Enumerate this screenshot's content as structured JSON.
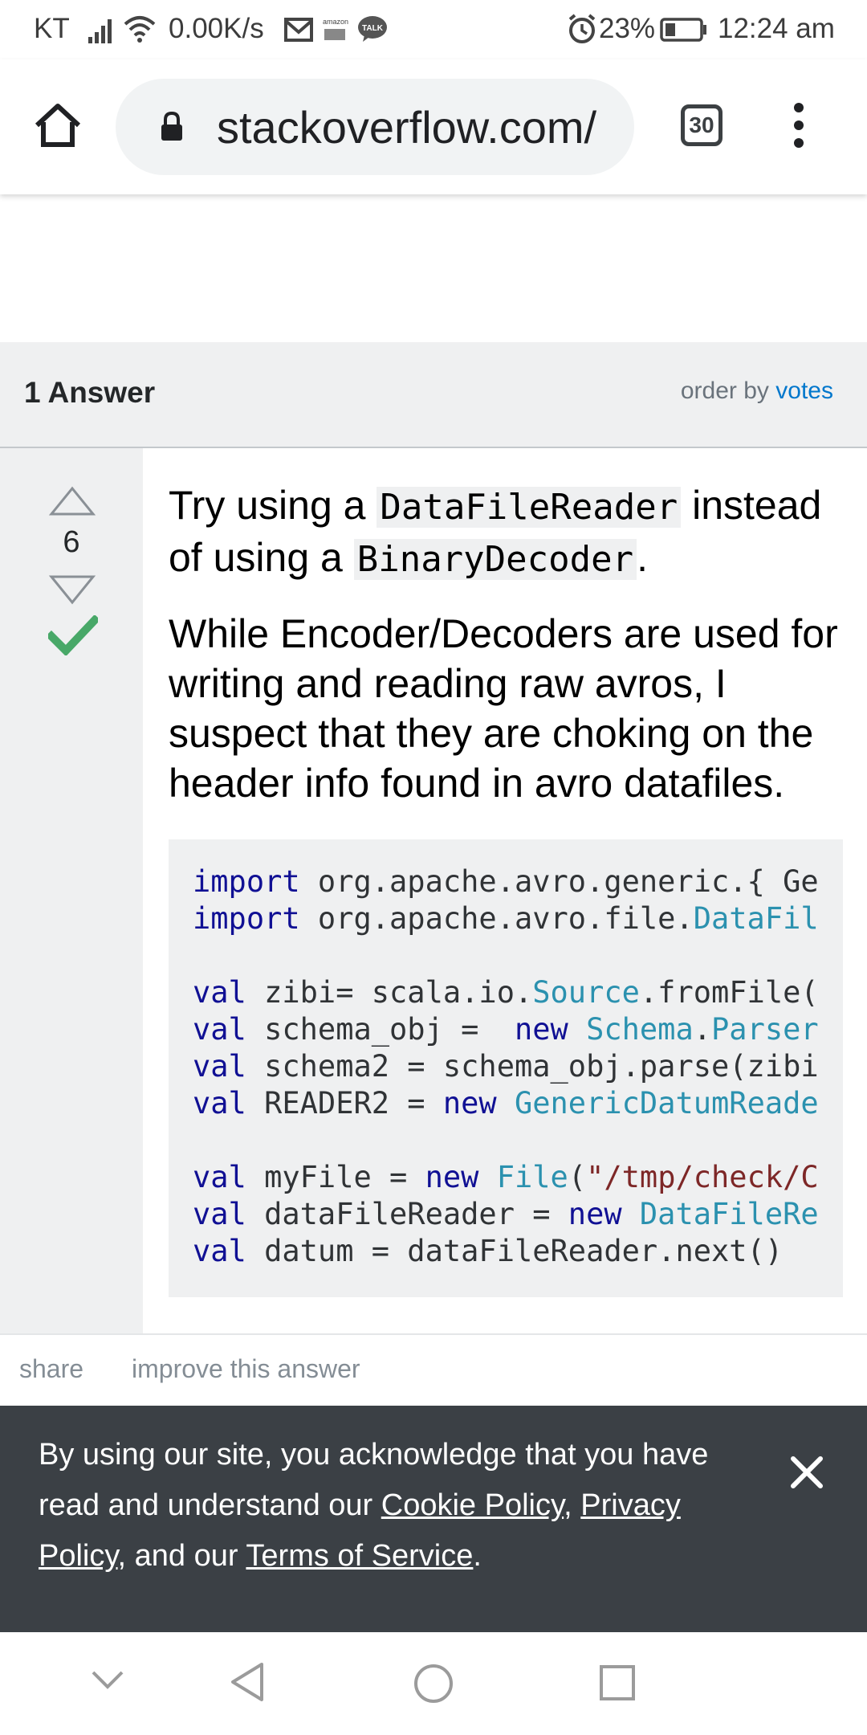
{
  "status_bar": {
    "carrier": "KT",
    "speed": "0.00K/s",
    "battery": "23%",
    "time": "12:24 am",
    "icons": [
      "signal-icon",
      "wifi-icon",
      "gmail-icon",
      "amazon-icon",
      "talk-icon",
      "alarm-icon",
      "battery-icon"
    ]
  },
  "browser": {
    "url": "stackoverflow.com/",
    "tab_count": "30"
  },
  "answers_header": {
    "title": "1 Answer",
    "order_by_label": "order by",
    "order_by_value": "votes"
  },
  "answer": {
    "votes": "6",
    "accepted": true,
    "line1_pre": "Try using a ",
    "line1_code1": "DataFileReader",
    "line1_mid": " instead of using a ",
    "line1_code2": "BinaryDecoder",
    "line1_post": ".",
    "paragraph2": "While Encoder/Decoders are used for writing and reading raw avros, I suspect that they are choking on the header info found in avro datafiles.",
    "code_lines": [
      "import org.apache.avro.generic.{ Ge",
      "import org.apache.avro.file.DataFil",
      "",
      "val zibi= scala.io.Source.fromFile(",
      "val schema_obj =  new Schema.Parser",
      "val schema2 = schema_obj.parse(zibi",
      "val READER2 = new GenericDatumReade",
      "",
      "val myFile = new File(\"/tmp/check/C",
      "val dataFileReader = new DataFileRe",
      "val datum = dataFileReader.next()"
    ]
  },
  "actions": {
    "share": "share",
    "improve": "improve this answer"
  },
  "cookie_banner": {
    "text_pre": "By using our site, you acknowledge that you have read and understand our ",
    "cookie_policy": "Cookie Policy",
    "comma": ", ",
    "privacy_policy": "Privacy Policy",
    "mid": ", and our ",
    "terms": "Terms of Service",
    "end": "."
  },
  "colors": {
    "link": "#0077cc",
    "accepted_check": "#48a868",
    "banner_bg": "#3b4045",
    "panel_bg": "#eff0f1"
  }
}
